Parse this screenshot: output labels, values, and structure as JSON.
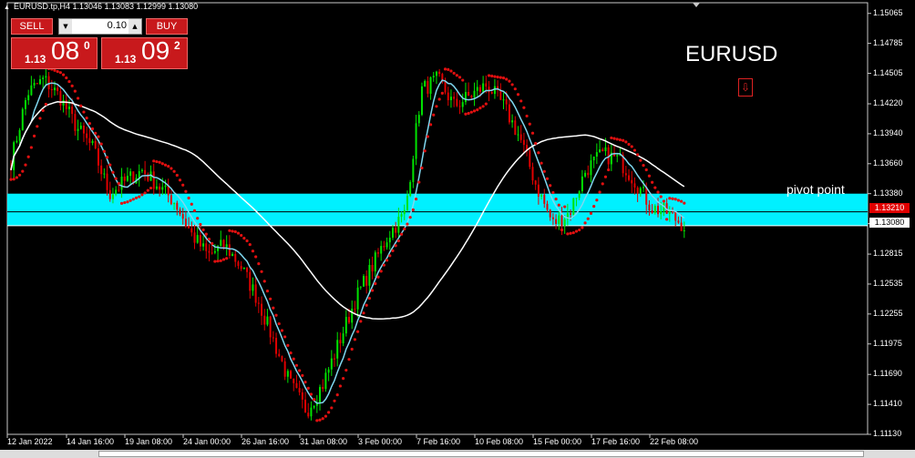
{
  "window": {
    "title": "EURUSD.tp,H4  1.13046 1.13083 1.12999 1.13080"
  },
  "trade_panel": {
    "sell_label": "SELL",
    "buy_label": "BUY",
    "lot": "0.10",
    "bid": {
      "small": "1.13",
      "big": "08",
      "sup": "0"
    },
    "ask": {
      "small": "1.13",
      "big": "09",
      "sup": "2"
    }
  },
  "annotations": {
    "symbol": "EURUSD",
    "pivot": "pivot point"
  },
  "price_tags": {
    "red": "1.13210",
    "white": "1.13080"
  },
  "colors": {
    "bull": "#00e400",
    "bear": "#e00000",
    "ma_fast": "#7fd7ef",
    "ma_slow": "#ffffff",
    "sar": "#e01010",
    "pivot_band": "#00f0ff"
  },
  "chart_data": {
    "type": "candlestick",
    "symbol": "EURUSD.tp",
    "timeframe": "H4",
    "y_ticks": [
      "1.15065",
      "1.14785",
      "1.14505",
      "1.14220",
      "1.13940",
      "1.13660",
      "1.13380",
      "1.13100",
      "1.12815",
      "1.12535",
      "1.12255",
      "1.11975",
      "1.11690",
      "1.11410",
      "1.11130"
    ],
    "x_ticks": [
      "12 Jan 2022",
      "14 Jan 16:00",
      "19 Jan 08:00",
      "24 Jan 00:00",
      "26 Jan 16:00",
      "31 Jan 08:00",
      "3 Feb 00:00",
      "7 Feb 16:00",
      "10 Feb 08:00",
      "15 Feb 00:00",
      "17 Feb 16:00",
      "22 Feb 08:00"
    ],
    "ylim": [
      1.1113,
      1.15165
    ],
    "pivot_band": [
      1.1308,
      1.1338
    ],
    "pivot_line": 1.1321,
    "last_price": 1.1308,
    "close_path": [
      1.1368,
      1.1432,
      1.1445,
      1.1428,
      1.14,
      1.138,
      1.1338,
      1.135,
      1.136,
      1.1345,
      1.133,
      1.13,
      1.128,
      1.129,
      1.127,
      1.124,
      1.12,
      1.116,
      1.1135,
      1.116,
      1.12,
      1.124,
      1.127,
      1.13,
      1.132,
      1.1435,
      1.1445,
      1.142,
      1.143,
      1.144,
      1.142,
      1.139,
      1.1345,
      1.131,
      1.132,
      1.136,
      1.1375,
      1.137,
      1.135,
      1.1325,
      1.132,
      1.1308
    ]
  }
}
